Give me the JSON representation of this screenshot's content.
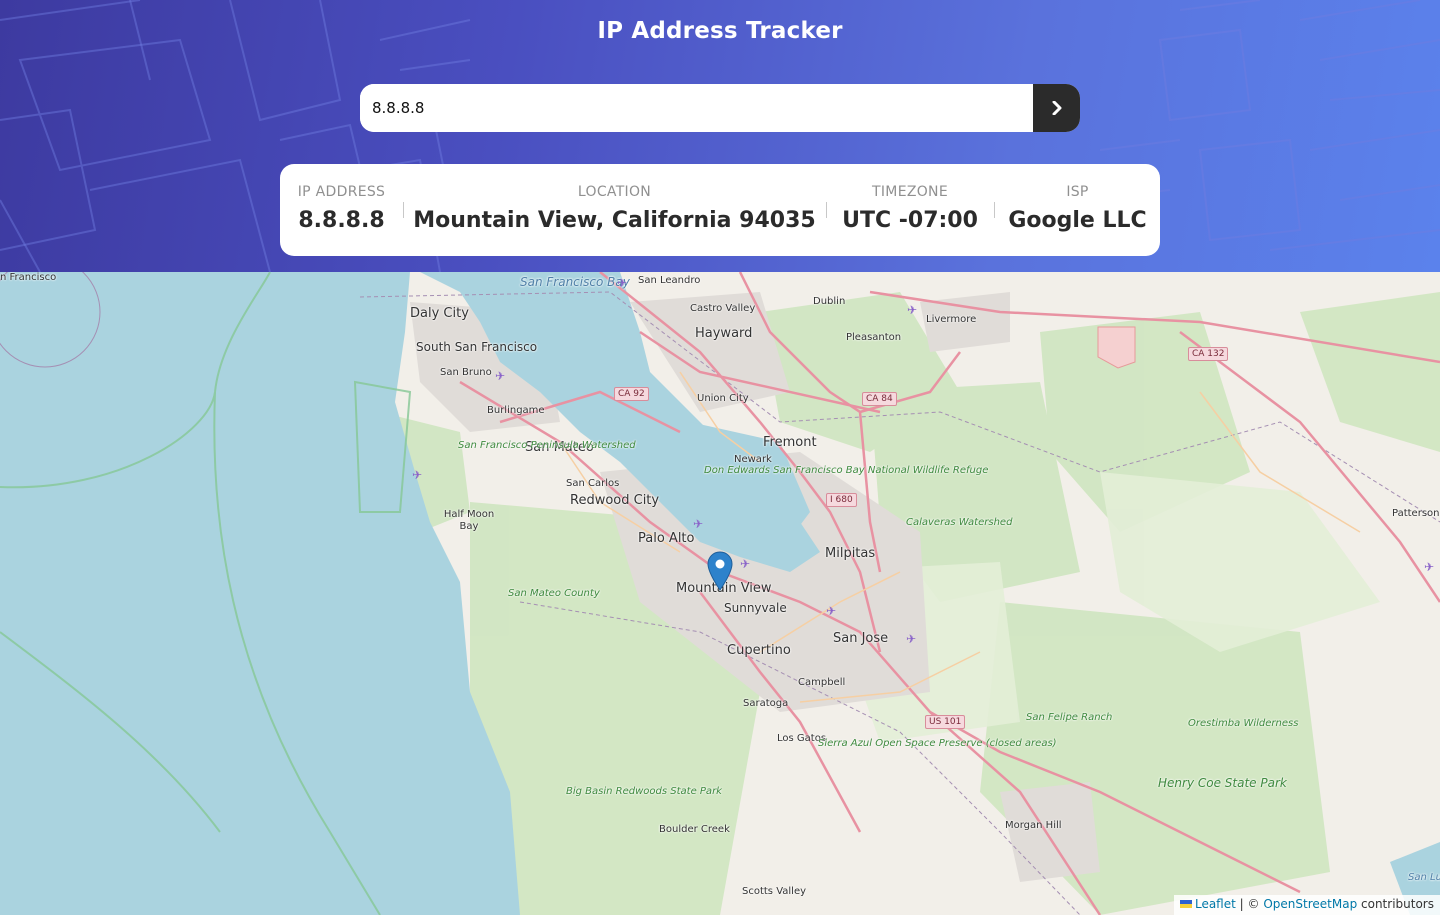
{
  "header": {
    "title": "IP Address Tracker",
    "search_value": "8.8.8.8",
    "submit_icon": "chevron-right-icon"
  },
  "info": {
    "ip": {
      "label": "IP ADDRESS",
      "value": "8.8.8.8"
    },
    "location": {
      "label": "LOCATION",
      "value": "Mountain View, California 94035"
    },
    "timezone": {
      "label": "TIMEZONE",
      "value": "UTC -07:00"
    },
    "isp": {
      "label": "ISP",
      "value": "Google LLC"
    }
  },
  "map": {
    "marker_icon": "map-pin-icon",
    "places": {
      "san_francisco": "n Francisco",
      "sf_bay": "San Francisco Bay",
      "san_leandro": "San Leandro",
      "daly_city": "Daly City",
      "south_sf": "South San Francisco",
      "san_bruno": "San Bruno",
      "burlingame": "Burlingame",
      "san_mateo": "San Mateo",
      "sf_watershed": "San Francisco Peninsula Watershed",
      "san_carlos": "San Carlos",
      "redwood_city": "Redwood City",
      "half_moon_bay": "Half Moon Bay",
      "palo_alto": "Palo Alto",
      "mountain_view": "Mountain View",
      "sunnyvale": "Sunnyvale",
      "san_mateo_county": "San Mateo County",
      "cupertino": "Cupertino",
      "castro_valley": "Castro Valley",
      "hayward": "Hayward",
      "dublin": "Dublin",
      "pleasanton": "Pleasanton",
      "livermore": "Livermore",
      "union_city": "Union City",
      "fremont": "Fremont",
      "newark": "Newark",
      "refuge": "Don Edwards San Francisco Bay National Wildlife Refuge",
      "milpitas": "Milpitas",
      "san_jose": "San Jose",
      "campbell": "Campbell",
      "saratoga": "Saratoga",
      "los_gatos": "Los Gatos",
      "sierra_azul": "Sierra Azul Open Space Preserve (closed areas)",
      "calaveras": "Calaveras Watershed",
      "san_felipe": "San Felipe Ranch",
      "orestimba": "Orestimba Wilderness",
      "henry_coe": "Henry Coe State Park",
      "morgan_hill": "Morgan Hill",
      "big_basin": "Big Basin Redwoods State Park",
      "boulder_creek": "Boulder Creek",
      "scotts_valley": "Scotts Valley",
      "patterson": "Patterson",
      "san_luis": "San Lu Reser"
    },
    "shields": {
      "ca92": "CA 92",
      "ca84": "CA 84",
      "i680": "I 680",
      "us101": "US 101",
      "ca132": "CA 132"
    },
    "attribution": {
      "leaflet": "Leaflet",
      "separator": "| ©",
      "osm": "OpenStreetMap",
      "contributors": "contributors"
    }
  }
}
